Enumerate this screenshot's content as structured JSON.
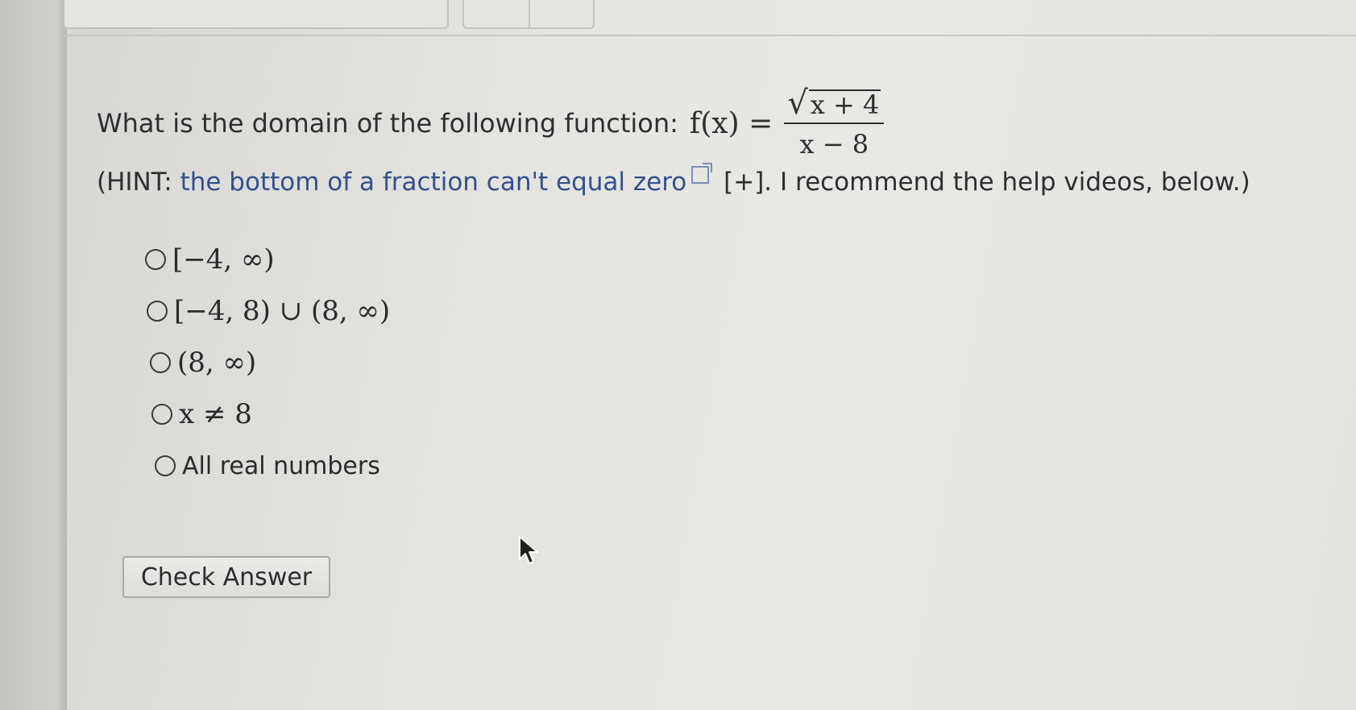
{
  "question": {
    "prompt": "What is the domain of the following function:",
    "function_lhs": "f(x) =",
    "numerator": "x + 4",
    "denominator": "x − 8",
    "hint_open": "(HINT: ",
    "hint_link": "the bottom of a fraction can't equal zero",
    "hint_plus": " [+]",
    "hint_close": ". I recommend the help videos, below.)"
  },
  "options": [
    {
      "label": "[−4, ∞)"
    },
    {
      "label": "[−4, 8) ∪ (8, ∞)"
    },
    {
      "label": "(8, ∞)"
    },
    {
      "label": "x ≠ 8"
    },
    {
      "label": "All real numbers"
    }
  ],
  "check_button": {
    "label": "Check Answer"
  },
  "icons": {
    "external_link": "external-link-icon",
    "cursor": "mouse-pointer-icon"
  },
  "colors": {
    "link": "#33508f",
    "text": "#2e2e2e",
    "background": "#e6e5e1"
  }
}
